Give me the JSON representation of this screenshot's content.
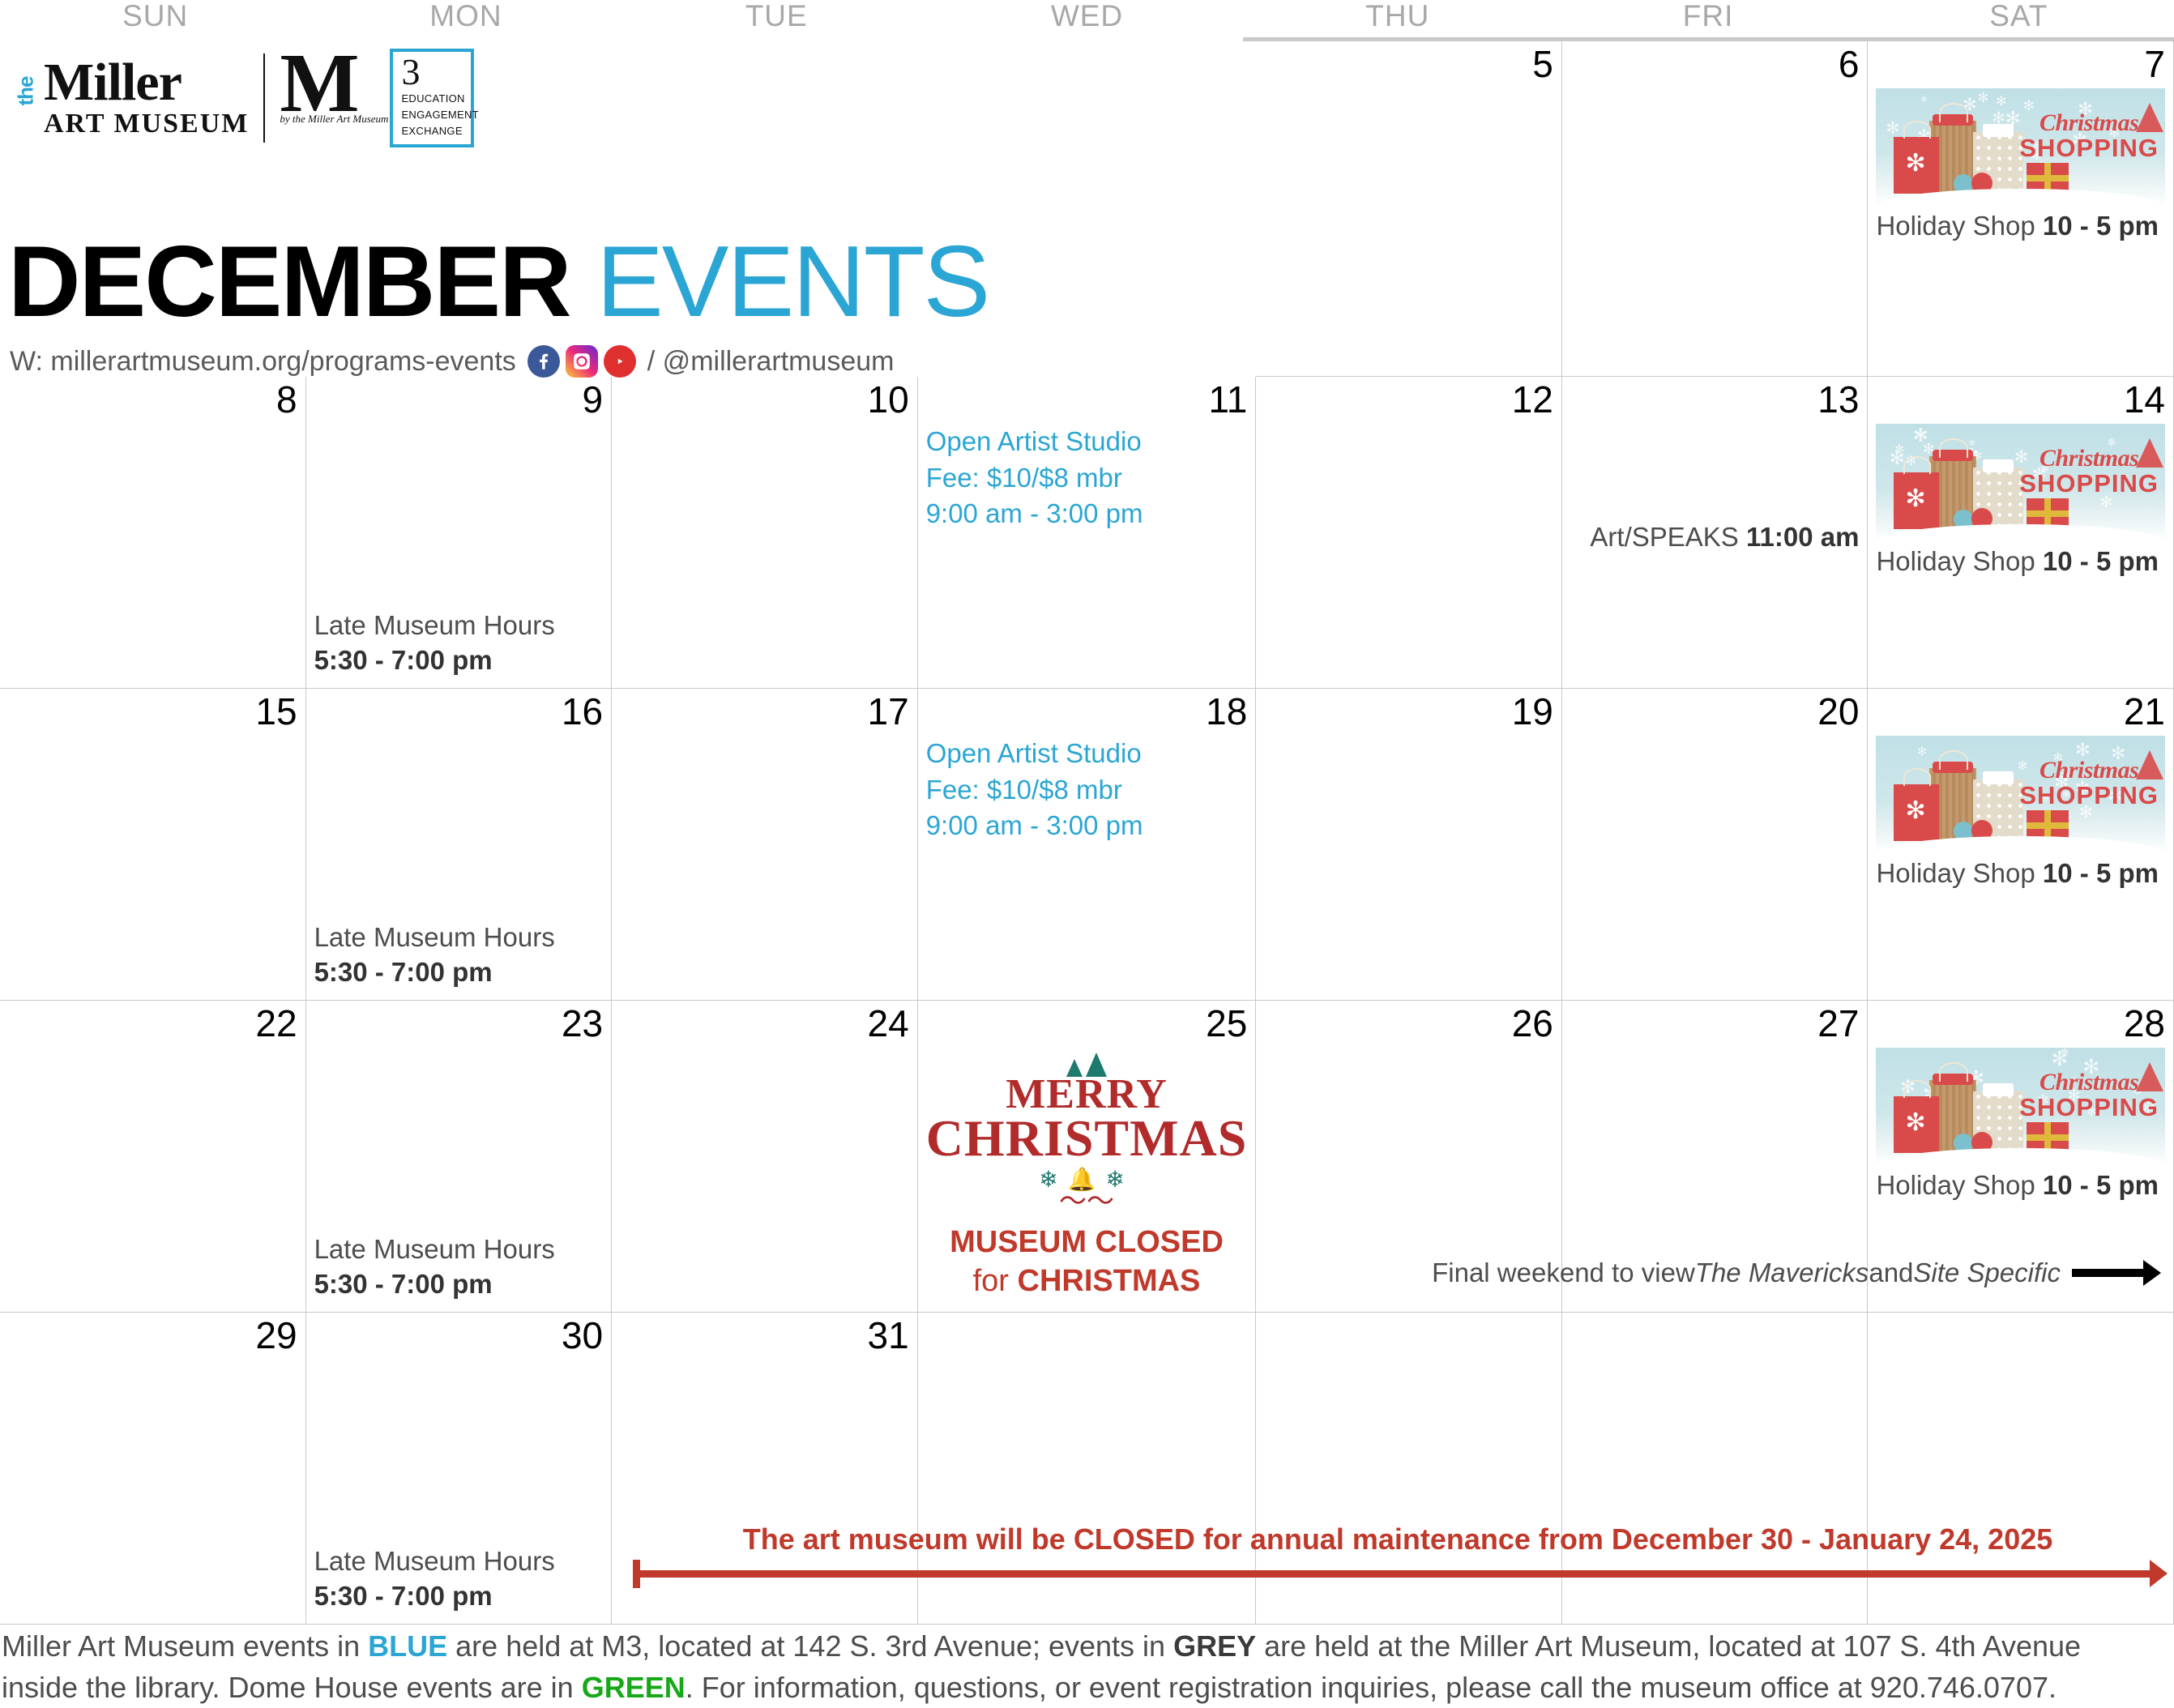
{
  "header": {
    "days_of_week": [
      "SUN",
      "MON",
      "TUE",
      "WED",
      "THU",
      "FRI",
      "SAT"
    ],
    "logo": {
      "the": "the",
      "miller": "Miller",
      "art_museum": "ART MUSEUM",
      "m_letter": "M",
      "by_line": "by the Miller Art Museum",
      "three": "3",
      "education": "EDUCATION",
      "engagement": "ENGAGEMENT",
      "exchange": "EXCHANGE"
    },
    "title_month": "DECEMBER",
    "title_events": "EVENTS",
    "web_prefix": "W: millerartmuseum.org/programs-events",
    "web_suffix": "/ @millerartmuseum",
    "social": [
      "facebook-icon",
      "instagram-icon",
      "youtube-icon"
    ]
  },
  "colors": {
    "blue": "#2ba6d4",
    "grey": "#4d4d4d",
    "green": "#17a81a",
    "red": "#c0392b",
    "gridline": "#c9c9c9"
  },
  "weeks": [
    {
      "days": [
        {
          "num": "",
          "blank": true
        },
        {
          "num": "",
          "blank": true
        },
        {
          "num": "",
          "blank": true
        },
        {
          "num": "",
          "blank": true
        },
        {
          "num": "5"
        },
        {
          "num": "6"
        },
        {
          "num": "7",
          "holiday_shop": true,
          "shop_label": "Holiday Shop ",
          "shop_time": "10 - 5 pm",
          "banner_christmas": "Christmas",
          "banner_shopping": "SHOPPING"
        }
      ]
    },
    {
      "days": [
        {
          "num": "8"
        },
        {
          "num": "9",
          "bottom_label": "Late Museum Hours",
          "bottom_time": "5:30 - 7:00 pm"
        },
        {
          "num": "10"
        },
        {
          "num": "11",
          "studio_title": "Open Artist Studio",
          "studio_fee": "Fee: $10/$8 mbr",
          "studio_time": "9:00 am - 3:00 pm"
        },
        {
          "num": "12"
        },
        {
          "num": "13",
          "mid_label": "Art/SPEAKS ",
          "mid_time": "11:00 am"
        },
        {
          "num": "14",
          "holiday_shop": true,
          "shop_label": "Holiday Shop ",
          "shop_time": "10 - 5 pm",
          "banner_christmas": "Christmas",
          "banner_shopping": "SHOPPING"
        }
      ]
    },
    {
      "days": [
        {
          "num": "15"
        },
        {
          "num": "16",
          "bottom_label": "Late Museum Hours",
          "bottom_time": "5:30 - 7:00 pm"
        },
        {
          "num": "17"
        },
        {
          "num": "18",
          "studio_title": "Open Artist Studio",
          "studio_fee": "Fee: $10/$8 mbr",
          "studio_time": "9:00 am - 3:00 pm"
        },
        {
          "num": "19"
        },
        {
          "num": "20"
        },
        {
          "num": "21",
          "holiday_shop": true,
          "shop_label": "Holiday Shop ",
          "shop_time": "10 - 5 pm",
          "banner_christmas": "Christmas",
          "banner_shopping": "SHOPPING"
        }
      ]
    },
    {
      "days": [
        {
          "num": "22"
        },
        {
          "num": "23",
          "bottom_label": "Late Museum Hours",
          "bottom_time": "5:30 - 7:00 pm"
        },
        {
          "num": "24"
        },
        {
          "num": "25",
          "xmas": true,
          "xmas_merry": "MERRY",
          "xmas_christmas": "CHRISTMAS",
          "closed_line1": "MUSEUM CLOSED",
          "closed_for": "for ",
          "closed_line2": "CHRISTMAS"
        },
        {
          "num": "26"
        },
        {
          "num": "27"
        },
        {
          "num": "28",
          "holiday_shop": true,
          "shop_label": "Holiday Shop ",
          "shop_time": "10 - 5 pm",
          "banner_christmas": "Christmas",
          "banner_shopping": "SHOPPING"
        }
      ]
    },
    {
      "days": [
        {
          "num": "29"
        },
        {
          "num": "30",
          "bottom_label": "Late Museum Hours",
          "bottom_time": "5:30 - 7:00 pm"
        },
        {
          "num": "31"
        },
        {
          "num": ""
        },
        {
          "num": ""
        },
        {
          "num": ""
        },
        {
          "num": ""
        }
      ]
    }
  ],
  "final_weekend": {
    "pre": "Final weekend to view ",
    "exhibit1": "The Mavericks",
    "mid": " and ",
    "exhibit2": "Site Specific"
  },
  "maintenance": {
    "text": "The art museum will be CLOSED for annual maintenance from  December 30 - January 24, 2025"
  },
  "footer": {
    "l1a": "Miller Art Museum events in ",
    "l1_blue": "BLUE",
    "l1b": " are held at M3, located at 142 S. 3rd Avenue; events in ",
    "l1_grey": "GREY",
    "l1c": " are held at the Miller Art Museum, located at 107 S. 4th Avenue",
    "l2a": "inside the library. Dome House events are in ",
    "l2_green": "GREEN",
    "l2b": ". For information, questions, or event registration inquiries, please call the museum office at 920.746.0707."
  }
}
